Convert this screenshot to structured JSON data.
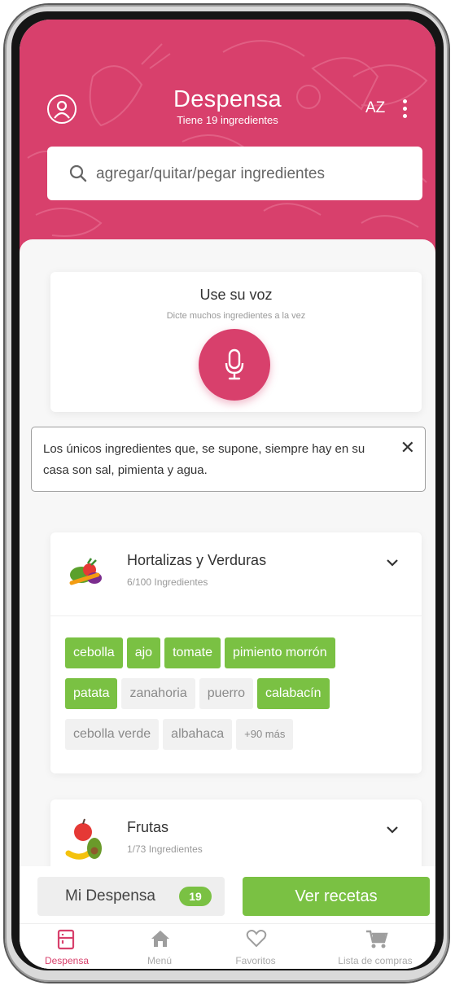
{
  "header": {
    "title": "Despensa",
    "subtitle": "Tiene 19 ingredientes",
    "sort_label": "AZ",
    "accent_color": "#d8406c"
  },
  "search": {
    "placeholder": "agregar/quitar/pegar ingredientes",
    "icon": "search-icon"
  },
  "voice": {
    "title": "Use su voz",
    "subtitle": "Dicte muchos ingredientes a la vez",
    "icon": "microphone-icon"
  },
  "notice": {
    "text": "Los únicos ingredientes que, se supone, siempre hay en su casa son sal, pimienta y agua.",
    "close": "✕"
  },
  "categories": [
    {
      "name": "Hortalizas y Verduras",
      "count": "6/100 Ingredientes",
      "icon": "vegetables-icon",
      "tags": [
        {
          "label": "cebolla",
          "selected": true
        },
        {
          "label": "ajo",
          "selected": true
        },
        {
          "label": "tomate",
          "selected": true
        },
        {
          "label": "pimiento morrón",
          "selected": true
        },
        {
          "label": "patata",
          "selected": true
        },
        {
          "label": "zanahoria",
          "selected": false
        },
        {
          "label": "puerro",
          "selected": false
        },
        {
          "label": "calabacín",
          "selected": true
        },
        {
          "label": "cebolla verde",
          "selected": false
        },
        {
          "label": "albahaca",
          "selected": false
        }
      ],
      "more": "+90 más"
    },
    {
      "name": "Frutas",
      "count": "1/73 Ingredientes",
      "icon": "fruits-icon"
    }
  ],
  "actions": {
    "pantry_label": "Mi Despensa",
    "pantry_badge": "19",
    "recipes_label": "Ver recetas",
    "selected_color": "#7ac143"
  },
  "tabs": [
    {
      "label": "Despensa",
      "icon": "pantry-icon",
      "active": true
    },
    {
      "label": "Menú",
      "icon": "home-icon",
      "active": false
    },
    {
      "label": "Favoritos",
      "icon": "heart-icon",
      "active": false
    },
    {
      "label": "Lista de compras",
      "icon": "cart-icon",
      "active": false
    }
  ]
}
